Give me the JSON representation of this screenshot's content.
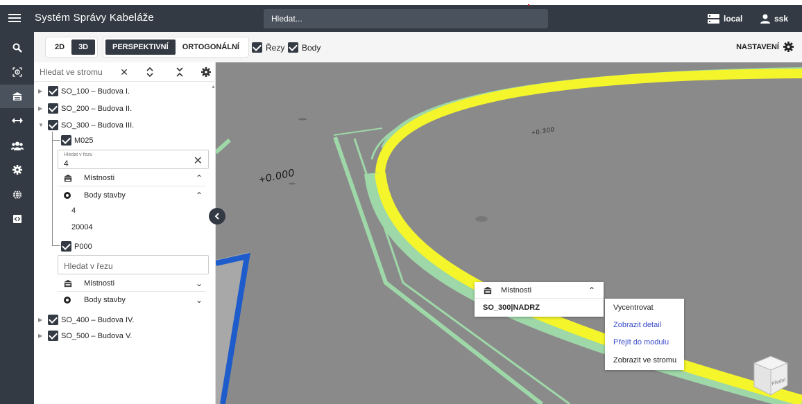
{
  "app": {
    "title": "Systém Správy Kabeláže"
  },
  "search": {
    "placeholder": "Hledat..."
  },
  "header": {
    "local_label": "local",
    "user_label": "ssk"
  },
  "toolbar": {
    "view_2d": "2D",
    "view_3d": "3D",
    "perspective": "PERSPEKTIVNÍ",
    "orthographic": "ORTOGONÁLNÍ",
    "sections_label": "Řezy",
    "points_label": "Body",
    "settings_label": "NASTAVENÍ"
  },
  "panel": {
    "search_placeholder": "Hledat ve stromu",
    "tree": [
      {
        "label": "SO_100 – Budova I.",
        "checked": true,
        "expanded": false
      },
      {
        "label": "SO_200 – Budova II.",
        "checked": true,
        "expanded": false
      },
      {
        "label": "SO_300 – Budova III.",
        "checked": true,
        "expanded": true
      },
      {
        "label": "SO_400 – Budova IV.",
        "checked": true,
        "expanded": false
      },
      {
        "label": "SO_500 – Budova V.",
        "checked": true,
        "expanded": false
      }
    ],
    "floor_m025": {
      "label": "M025",
      "filter_label": "Hledat v řezu",
      "filter_value": "4",
      "rooms_label": "Místnosti",
      "points_label": "Body stavby",
      "values": [
        "4",
        "20004"
      ]
    },
    "floor_p000": {
      "label": "P000",
      "filter_placeholder": "Hledat v řezu",
      "rooms_label": "Místnosti",
      "points_label": "Body stavby"
    }
  },
  "viewport": {
    "elevation_labels": [
      "+0.000",
      "+0.300"
    ],
    "cube_label": "Přední"
  },
  "popup": {
    "title": "Místnosti",
    "value": "SO_300|NADRZ"
  },
  "context_menu": {
    "items": [
      {
        "label": "Vycentrovat",
        "link": false
      },
      {
        "label": "Zobrazit detail",
        "link": true
      },
      {
        "label": "Přejít do modulu",
        "link": true
      },
      {
        "label": "Zobrazit ve stromu",
        "link": false
      }
    ]
  },
  "colors": {
    "dark": "#333a43",
    "viewport_bg": "#8a8a8a",
    "wall_green": "#9fd8a8",
    "highlight_yellow": "#f4f52a",
    "cable_blue": "#1e5ccc",
    "link_blue": "#3a4dc9"
  }
}
